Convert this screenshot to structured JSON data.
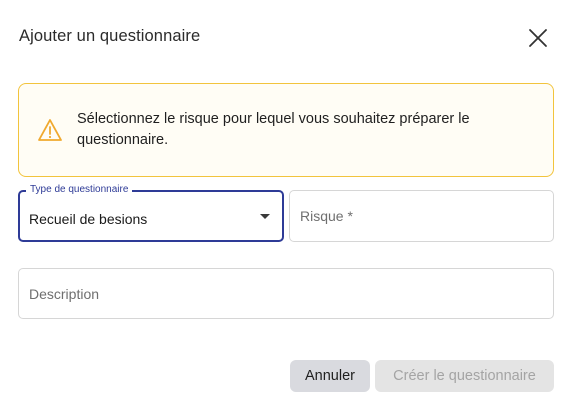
{
  "dialog": {
    "title": "Ajouter un questionnaire",
    "close_icon": "close-icon"
  },
  "alert": {
    "icon": "warning-icon",
    "message": "Sélectionnez le risque pour lequel vous souhaitez préparer le questionnaire.",
    "border_color": "#f2c43d"
  },
  "form": {
    "type_field": {
      "label": "Type de questionnaire",
      "value": "Recueil de besions",
      "icon": "dropdown-arrow-icon"
    },
    "risque_field": {
      "placeholder": "Risque *"
    },
    "description_field": {
      "placeholder": "Description"
    }
  },
  "actions": {
    "cancel_label": "Annuler",
    "create_label": "Créer le questionnaire"
  },
  "colors": {
    "accent": "#2e3b97",
    "warning": "#f2c43d"
  }
}
